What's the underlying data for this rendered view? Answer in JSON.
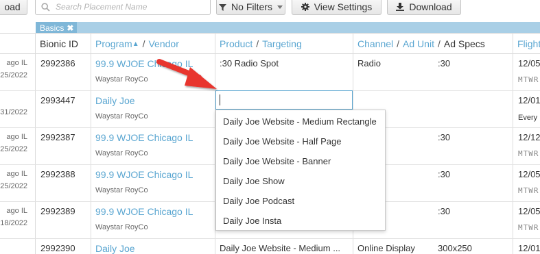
{
  "toolbar": {
    "load_label": "oad",
    "search_placeholder": "Search Placement Name",
    "filters_label": "No Filters",
    "view_settings_label": "View Settings",
    "download_label": "Download"
  },
  "basics_tag": {
    "label": "Basics",
    "close": "✖"
  },
  "colors": {
    "link": "#5aa6d1",
    "band": "#a9cfe6",
    "tag": "#7fb7d8",
    "arrow": "#e8352f"
  },
  "columns": {
    "bionic_id": "Bionic ID",
    "program": "Program",
    "sort_indicator": "▲",
    "vendor": "Vendor",
    "product": "Product",
    "targeting": "Targeting",
    "channel": "Channel",
    "ad_unit": "Ad Unit",
    "ad_specs": "Ad Specs",
    "flight": "Flight"
  },
  "separator": "/",
  "rows": [
    {
      "date1": "ago IL",
      "date2": "25/2022",
      "id": "2992386",
      "program": "99.9 WJOE Chicago IL",
      "vendor": "Waystar RoyCo",
      "product": ":30 Radio Spot",
      "channel": "Radio",
      "spec": ":30",
      "flight": "12/05/",
      "days": "MTWR"
    },
    {
      "date1": "",
      "date2": "31/2022",
      "id": "2993447",
      "program": "Daily Joe",
      "vendor": "Waystar RoyCo",
      "product": "",
      "channel": "",
      "spec": "",
      "flight": "12/01/",
      "days": "Every D"
    },
    {
      "date1": "ago IL",
      "date2": "25/2022",
      "id": "2992387",
      "program": "99.9 WJOE Chicago IL",
      "vendor": "Waystar RoyCo",
      "product": "",
      "channel": "",
      "spec": ":30",
      "flight": "12/12/",
      "days": "MTWR"
    },
    {
      "date1": "ago IL",
      "date2": "25/2022",
      "id": "2992388",
      "program": "99.9 WJOE Chicago IL",
      "vendor": "Waystar RoyCo",
      "product": "",
      "channel": "",
      "spec": ":30",
      "flight": "12/05/",
      "days": "MTWR"
    },
    {
      "date1": "ago IL",
      "date2": "18/2022",
      "id": "2992389",
      "program": "99.9 WJOE Chicago IL",
      "vendor": "Waystar RoyCo",
      "product": "",
      "channel": "",
      "spec": ":30",
      "flight": "12/05/",
      "days": "MTWR"
    },
    {
      "date1": "",
      "date2": "",
      "id": "2992390",
      "program": "Daily Joe",
      "vendor": "",
      "product": "Daily Joe Website - Medium ...",
      "channel": "Online Display",
      "spec": "300x250",
      "flight": "12/01/",
      "days": ""
    }
  ],
  "edit_input": {
    "value": ""
  },
  "dropdown_options": [
    "Daily Joe Website - Medium Rectangle",
    "Daily Joe Website - Half Page",
    "Daily Joe Website - Banner",
    "Daily Joe Show",
    "Daily Joe Podcast",
    "Daily Joe Insta"
  ]
}
